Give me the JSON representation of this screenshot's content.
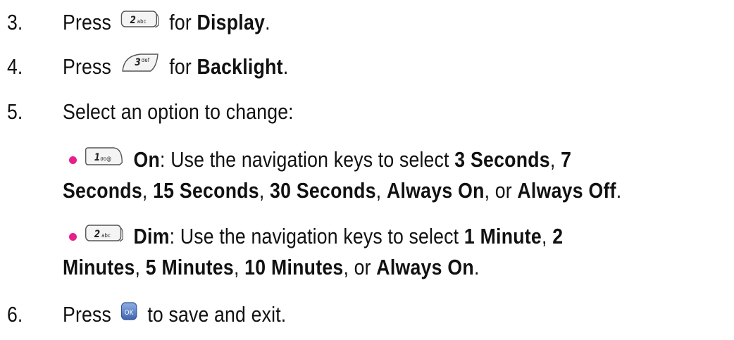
{
  "steps": [
    {
      "num": "3.",
      "pre": "Press",
      "key": "2abc",
      "mid": "for",
      "bold": "Display",
      "end": "."
    },
    {
      "num": "4.",
      "pre": "Press",
      "key": "3def",
      "mid": "for",
      "bold": "Backlight",
      "end": "."
    },
    {
      "num": "5.",
      "text": "Select an option to change:"
    },
    {
      "num": "6.",
      "pre": "Press",
      "key": "ok",
      "rest": "to save and exit."
    }
  ],
  "options": [
    {
      "key": "1",
      "name": "On",
      "intro": ": Use the navigation keys to select ",
      "line1_tail_bold": "3 Seconds",
      "line1_sep": ", ",
      "line1_end_bold": "7",
      "line2": [
        {
          "b": "Seconds"
        },
        {
          "t": ", "
        },
        {
          "b": "15 Seconds"
        },
        {
          "t": ", "
        },
        {
          "b": "30 Seconds"
        },
        {
          "t": ", "
        },
        {
          "b": "Always On"
        },
        {
          "t": ", or "
        },
        {
          "b": "Always Off"
        },
        {
          "t": "."
        }
      ]
    },
    {
      "key": "2",
      "name": "Dim",
      "intro": ": Use the navigation keys to select ",
      "line1_tail_bold": "1 Minute",
      "line1_sep": ", ",
      "line1_end_bold": "2",
      "line2": [
        {
          "b": "Minutes"
        },
        {
          "t": ", "
        },
        {
          "b": "5 Minutes"
        },
        {
          "t": ", "
        },
        {
          "b": "10 Minutes"
        },
        {
          "t": ", or "
        },
        {
          "b": "Always On"
        },
        {
          "t": "."
        }
      ]
    }
  ],
  "colors": {
    "bullet": "#e81f8a",
    "ok_key": "#4a6fb8"
  },
  "icons": [
    "key-2abc-icon",
    "key-3def-icon",
    "key-1-icon",
    "key-ok-icon"
  ]
}
